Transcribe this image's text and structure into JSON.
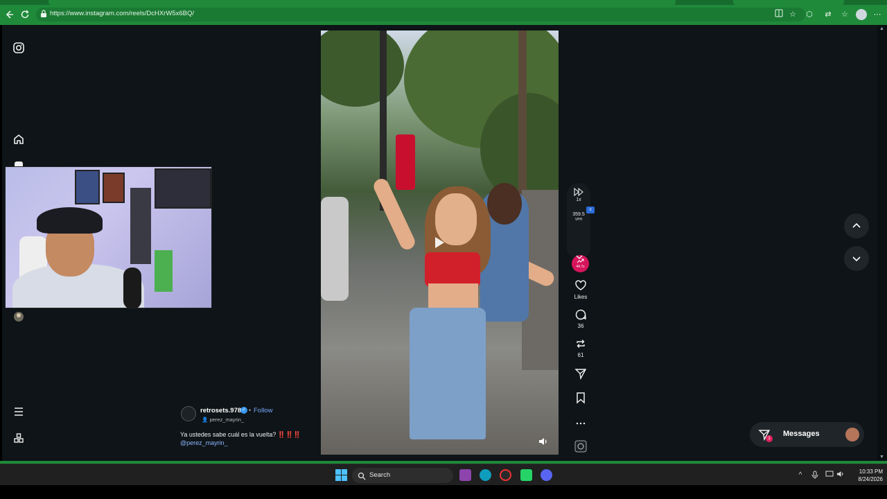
{
  "browser": {
    "url": "https://www.instagram.com/reels/DcHXrW5x6BQ/"
  },
  "reel_controls": {
    "speed": "1x",
    "badge": "X",
    "views_value": "359.5",
    "views_unit": "VPH",
    "trend_value": "44.7x"
  },
  "actions": {
    "likes_label": "Likes",
    "comments_count": "36",
    "reposts_count": "61"
  },
  "post": {
    "author": "retrosets.978",
    "separator": "•",
    "follow_label": "Follow",
    "collaborator": "perez_mayrin_",
    "caption": "Ya ustedes sabe cuál es la vuelta? ‼️‼️‼️",
    "mention": "@perez_mayrin_"
  },
  "messages": {
    "label": "Messages",
    "unread": "1"
  },
  "taskbar": {
    "search_label": "Search",
    "time": "10:33 PM",
    "date": "8/24/2026"
  },
  "colors": {
    "chrome_accent": "#1f8a3a",
    "trend_pink": "#d5145b",
    "follow_blue": "#7ba7ff"
  }
}
